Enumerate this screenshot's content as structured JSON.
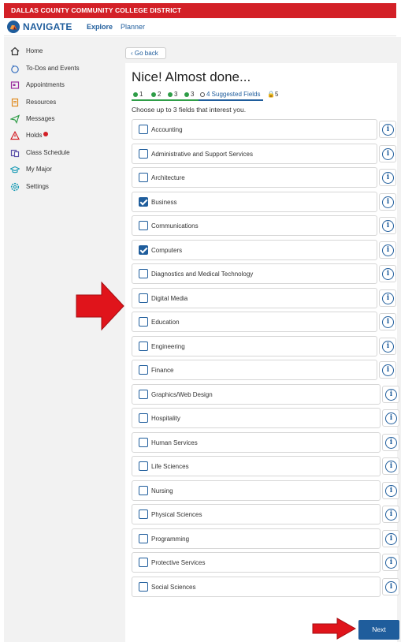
{
  "banner": {
    "text": "DALLAS COUNTY COMMUNITY COLLEGE DISTRICT"
  },
  "topnav": {
    "logo": "NAVIGATE",
    "explore": "Explore",
    "planner": "Planner"
  },
  "sidebar": {
    "items": [
      {
        "label": "Home",
        "icon": "home-icon"
      },
      {
        "label": "To-Dos and Events",
        "icon": "todo-icon"
      },
      {
        "label": "Appointments",
        "icon": "appointments-icon"
      },
      {
        "label": "Resources",
        "icon": "resources-icon"
      },
      {
        "label": "Messages",
        "icon": "messages-icon"
      },
      {
        "label": "Holds",
        "icon": "warning-icon"
      },
      {
        "label": "Class Schedule",
        "icon": "schedule-icon"
      },
      {
        "label": "My Major",
        "icon": "graduation-cap-icon"
      },
      {
        "label": "Settings",
        "icon": "gear-icon"
      }
    ]
  },
  "main": {
    "goback": "Go back",
    "heading": "Nice! Almost done...",
    "steps": [
      "1",
      "2",
      "3",
      "3",
      "4 Suggested Fields",
      "5"
    ],
    "instruction": "Choose up to 3 fields that interest you.",
    "fields": [
      {
        "label": "Accounting",
        "checked": false
      },
      {
        "label": "Administrative and Support Services",
        "checked": false
      },
      {
        "label": "Architecture",
        "checked": false
      },
      {
        "label": "Business",
        "checked": true
      },
      {
        "label": "Communications",
        "checked": false
      },
      {
        "label": "Computers",
        "checked": true
      },
      {
        "label": "Diagnostics and Medical Technology",
        "checked": false
      },
      {
        "label": "Digital Media",
        "checked": false
      },
      {
        "label": "Education",
        "checked": false
      },
      {
        "label": "Engineering",
        "checked": false
      },
      {
        "label": "Finance",
        "checked": false
      },
      {
        "label": "Graphics/Web Design",
        "checked": false
      },
      {
        "label": "Hospitality",
        "checked": false
      },
      {
        "label": "Human Services",
        "checked": false
      },
      {
        "label": "Life Sciences",
        "checked": false
      },
      {
        "label": "Nursing",
        "checked": false
      },
      {
        "label": "Physical Sciences",
        "checked": false
      },
      {
        "label": "Programming",
        "checked": false
      },
      {
        "label": "Protective Services",
        "checked": false
      },
      {
        "label": "Social Sciences",
        "checked": false
      }
    ],
    "next": "Next"
  },
  "colors": {
    "brand": "#1f5d9c",
    "banner": "#d32027",
    "step_done": "#2e9d47",
    "arrow": "#e0141b"
  }
}
